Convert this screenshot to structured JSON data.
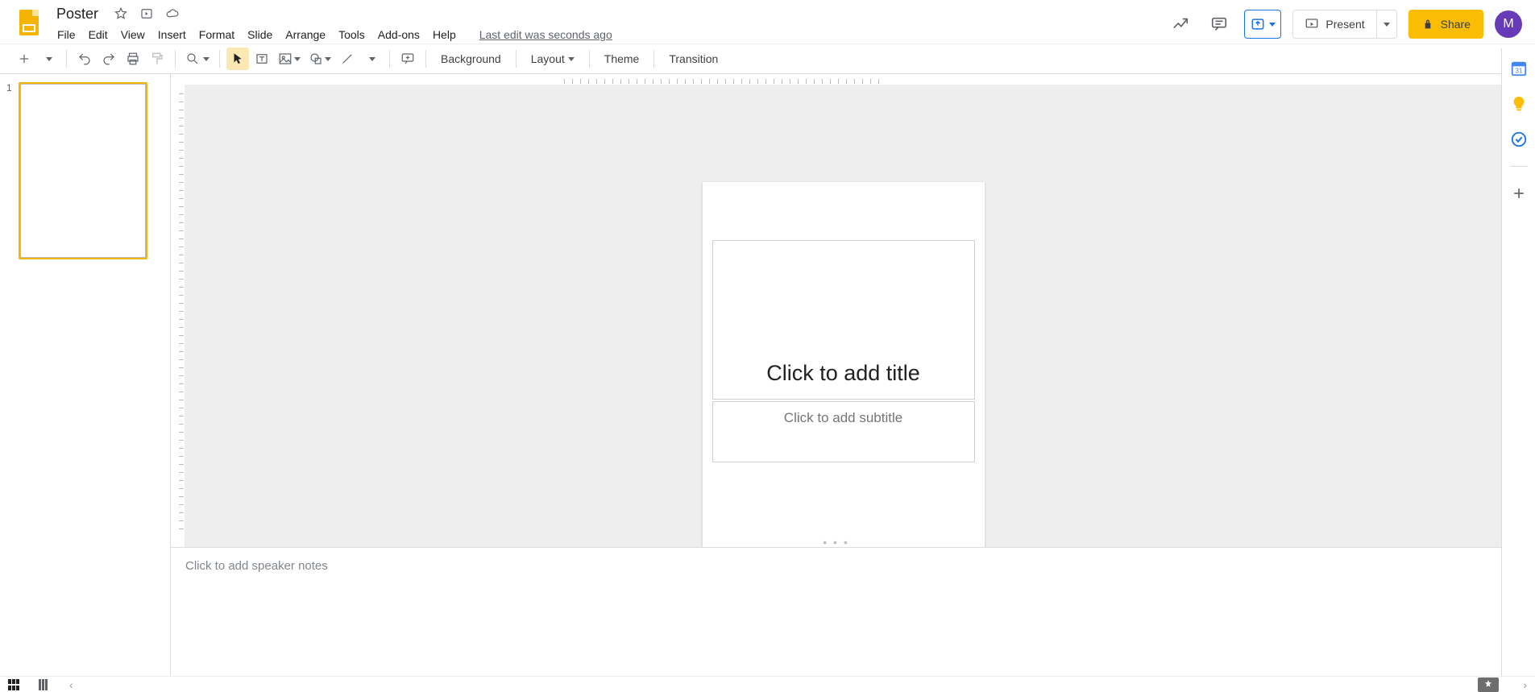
{
  "doc": {
    "title": "Poster",
    "lastEdit": "Last edit was seconds ago"
  },
  "menus": [
    "File",
    "Edit",
    "View",
    "Insert",
    "Format",
    "Slide",
    "Arrange",
    "Tools",
    "Add-ons",
    "Help"
  ],
  "header": {
    "present": "Present",
    "share": "Share",
    "avatar": "M"
  },
  "toolbar": {
    "background": "Background",
    "layout": "Layout",
    "theme": "Theme",
    "transition": "Transition"
  },
  "filmstrip": {
    "slides": [
      {
        "num": "1"
      }
    ]
  },
  "slide": {
    "titlePlaceholder": "Click to add title",
    "subtitlePlaceholder": "Click to add subtitle"
  },
  "notes": {
    "placeholder": "Click to add speaker notes"
  }
}
